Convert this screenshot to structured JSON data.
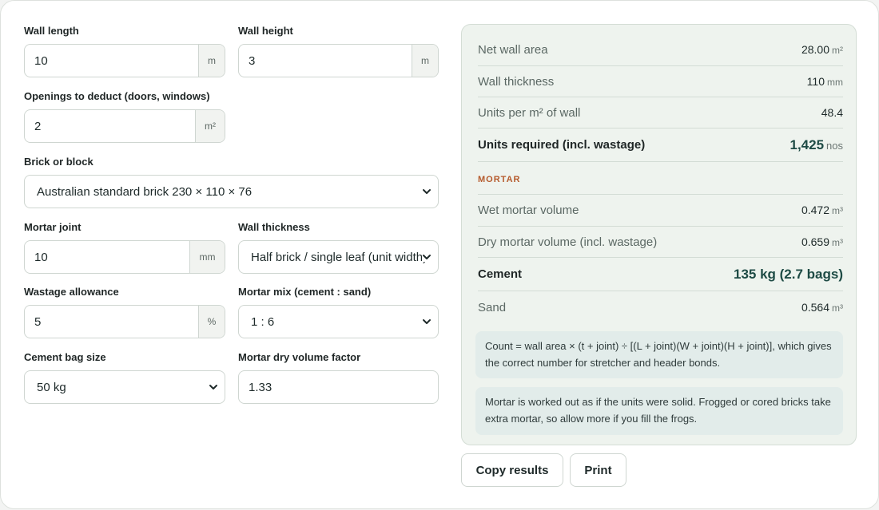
{
  "inputs": {
    "wall_length": {
      "label": "Wall length",
      "value": "10",
      "unit": "m"
    },
    "wall_height": {
      "label": "Wall height",
      "value": "3",
      "unit": "m"
    },
    "openings": {
      "label": "Openings to deduct (doors, windows)",
      "value": "2",
      "unit": "m²"
    },
    "brick": {
      "label": "Brick or block",
      "value": "Australian standard brick 230 × 110 × 76"
    },
    "mortar_joint": {
      "label": "Mortar joint",
      "value": "10",
      "unit": "mm"
    },
    "wall_thickness": {
      "label": "Wall thickness",
      "value": "Half brick / single leaf (unit width)"
    },
    "wastage": {
      "label": "Wastage allowance",
      "value": "5",
      "unit": "%"
    },
    "mortar_mix": {
      "label": "Mortar mix (cement : sand)",
      "value": "1 : 6"
    },
    "cement_bag": {
      "label": "Cement bag size",
      "value": "50 kg"
    },
    "dry_factor": {
      "label": "Mortar dry volume factor",
      "value": "1.33"
    }
  },
  "results": {
    "net_area": {
      "label": "Net wall area",
      "value": "28.00",
      "unit": "m²"
    },
    "thickness": {
      "label": "Wall thickness",
      "value": "110",
      "unit": "mm"
    },
    "units_per_m2": {
      "label": "Units per m² of wall",
      "value": "48.4"
    },
    "units_required": {
      "label": "Units required (incl. wastage)",
      "value": "1,425",
      "unit": "nos"
    },
    "mortar_heading": "MORTAR",
    "wet_mortar": {
      "label": "Wet mortar volume",
      "value": "0.472",
      "unit": "m³"
    },
    "dry_mortar": {
      "label": "Dry mortar volume (incl. wastage)",
      "value": "0.659",
      "unit": "m³"
    },
    "cement": {
      "label": "Cement",
      "value": "135 kg (2.7 bags)"
    },
    "sand": {
      "label": "Sand",
      "value": "0.564",
      "unit": "m³"
    }
  },
  "notes": {
    "formula": "Count = wall area × (t + joint) ÷ [(L + joint)(W + joint)(H + joint)], which gives the correct number for stretcher and header bonds.",
    "mortar": "Mortar is worked out as if the units were solid. Frogged or cored bricks take extra mortar, so allow more if you fill the frogs."
  },
  "buttons": {
    "copy": "Copy results",
    "print": "Print"
  },
  "icons": {
    "select": "chevron-down-icon"
  }
}
